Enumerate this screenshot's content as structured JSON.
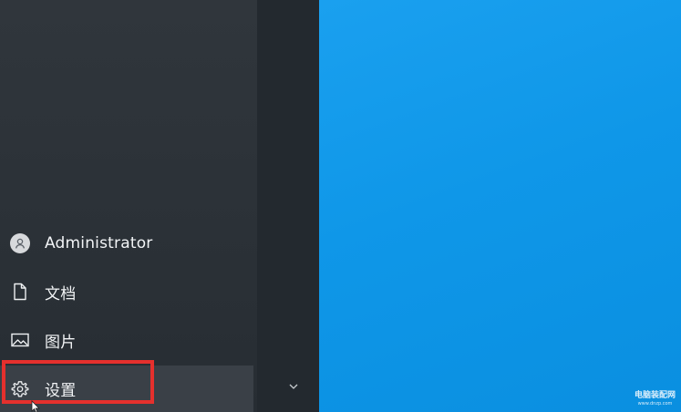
{
  "start_menu": {
    "user": {
      "label": "Administrator",
      "icon": "user-avatar-icon"
    },
    "items": [
      {
        "label": "文档",
        "icon": "document-icon"
      },
      {
        "label": "图片",
        "icon": "picture-icon"
      },
      {
        "label": "设置",
        "icon": "gear-icon"
      }
    ],
    "expand_icon": "chevron-down-icon",
    "highlight_color": "#e5302d"
  },
  "desktop": {
    "background_color": "#0f97e8"
  },
  "watermark": {
    "line1": "电脑装配网",
    "line2": "www.dnzp.com"
  }
}
